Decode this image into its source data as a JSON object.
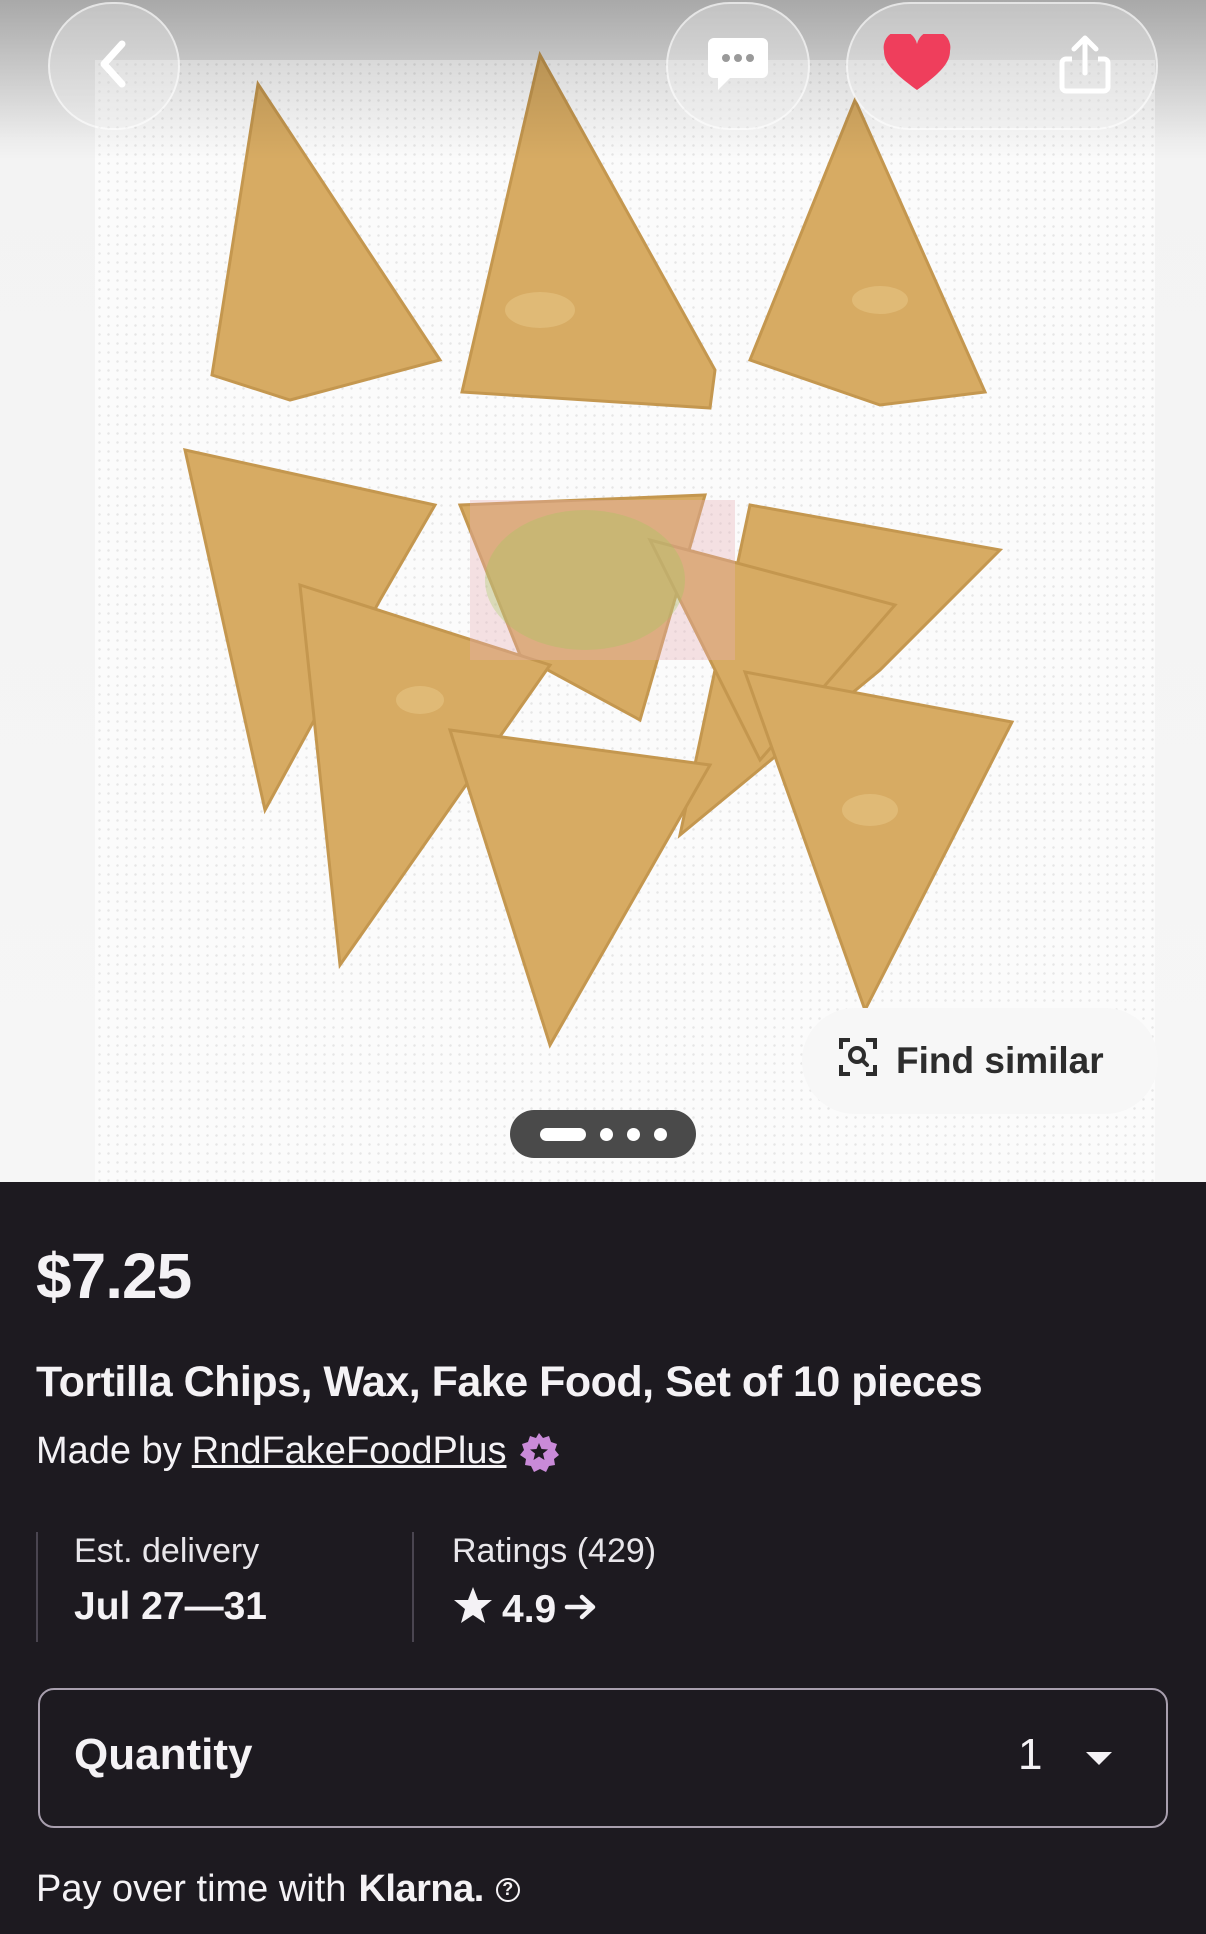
{
  "hero": {
    "image_alt": "Tortilla chips wax fake food on white mat",
    "find_similar_label": "Find similar",
    "carousel": {
      "slides": 4,
      "active_index": 0
    }
  },
  "listing": {
    "price": "$7.25",
    "title": "Tortilla Chips, Wax, Fake Food, Set of 10 pieces",
    "made_by_prefix": "Made by",
    "shop_name": "RndFakeFoodPlus"
  },
  "delivery": {
    "label": "Est. delivery",
    "value": "Jul 27—31"
  },
  "ratings": {
    "label": "Ratings (429)",
    "value": "4.9"
  },
  "quantity": {
    "label": "Quantity",
    "value": "1"
  },
  "klarna": {
    "prefix": "Pay over time with",
    "brand": "Klarna."
  },
  "colors": {
    "heart": "#ef3e5c",
    "badge": "#c98ad8",
    "background": "#1d1a20"
  },
  "icons": [
    "back-icon",
    "message-icon",
    "heart-icon",
    "share-icon",
    "find-similar-icon",
    "star-badge-icon",
    "star-icon",
    "arrow-right-icon",
    "chevron-down-icon",
    "help-icon"
  ]
}
